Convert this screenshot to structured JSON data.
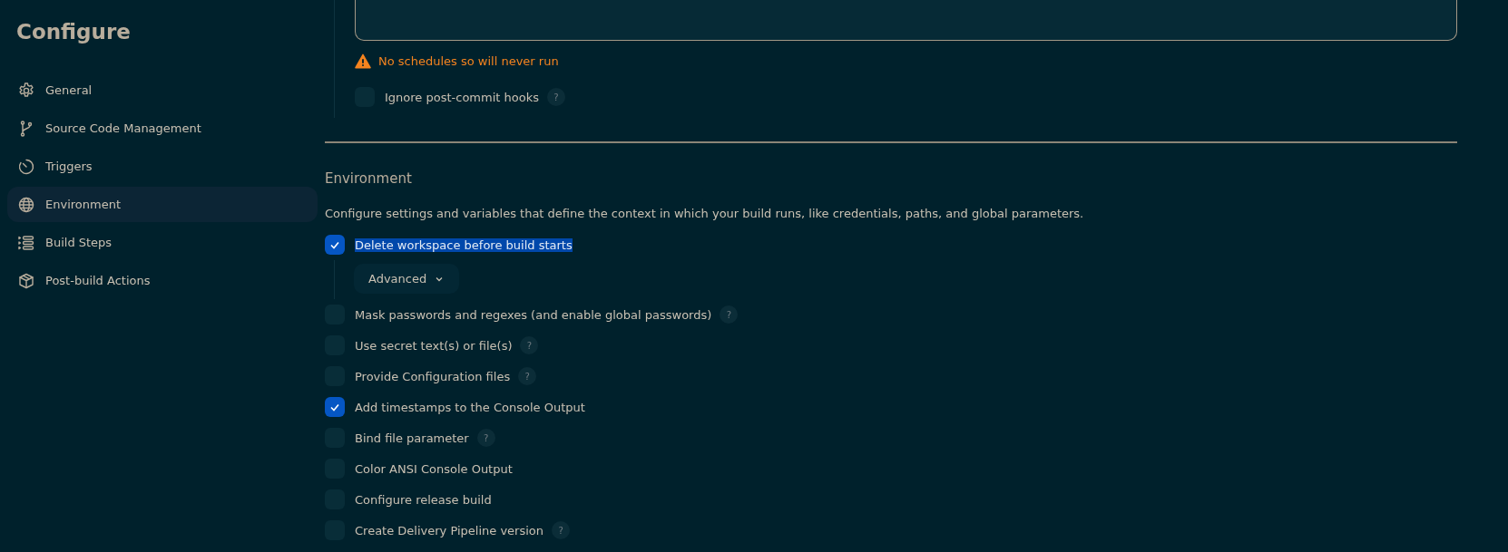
{
  "sidebar": {
    "title": "Configure",
    "items": [
      {
        "label": "General",
        "selected": false
      },
      {
        "label": "Source Code Management",
        "selected": false
      },
      {
        "label": "Triggers",
        "selected": false
      },
      {
        "label": "Environment",
        "selected": true
      },
      {
        "label": "Build Steps",
        "selected": false
      },
      {
        "label": "Post-build Actions",
        "selected": false
      }
    ]
  },
  "triggers": {
    "warning": "No schedules so will never run",
    "options": [
      {
        "label": "Ignore post-commit hooks",
        "checked": false,
        "help": "?"
      }
    ]
  },
  "environment": {
    "heading": "Environment",
    "description": "Configure settings and variables that define the context in which your build runs, like credentials, paths, and global parameters.",
    "options": [
      {
        "label": "Delete workspace before build starts",
        "checked": true,
        "highlighted": true,
        "advanced": "Advanced"
      },
      {
        "label": "Mask passwords and regexes (and enable global passwords)",
        "checked": false,
        "highlighted": false,
        "help": "?"
      },
      {
        "label": "Use secret text(s) or file(s)",
        "checked": false,
        "highlighted": false,
        "help": "?"
      },
      {
        "label": "Provide Configuration files",
        "checked": false,
        "highlighted": false,
        "help": "?"
      },
      {
        "label": "Add timestamps to the Console Output",
        "checked": true,
        "highlighted": false
      },
      {
        "label": "Bind file parameter",
        "checked": false,
        "highlighted": false,
        "help": "?"
      },
      {
        "label": "Color ANSI Console Output",
        "checked": false,
        "highlighted": false
      },
      {
        "label": "Configure release build",
        "checked": false,
        "highlighted": false
      },
      {
        "label": "Create Delivery Pipeline version",
        "checked": false,
        "highlighted": false,
        "help": "?"
      }
    ]
  }
}
